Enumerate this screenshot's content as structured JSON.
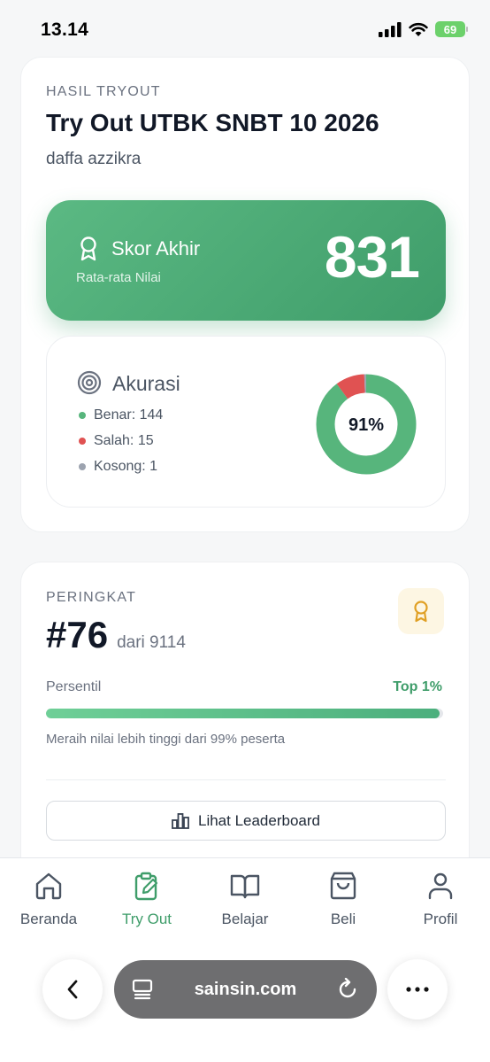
{
  "status_bar": {
    "time": "13.14",
    "battery": "69"
  },
  "result_card": {
    "overline": "HASIL TRYOUT",
    "title": "Try Out UTBK SNBT 10 2026",
    "student_name": "daffa azzikra",
    "score": {
      "label": "Skor Akhir",
      "sublabel": "Rata-rata Nilai",
      "value": "831"
    },
    "accuracy": {
      "title": "Akurasi",
      "percent_label": "91%",
      "items": [
        {
          "label": "Benar: 144",
          "count": 144,
          "color": "#57b57c"
        },
        {
          "label": "Salah: 15",
          "count": 15,
          "color": "#e05252"
        },
        {
          "label": "Kosong: 1",
          "count": 1,
          "color": "#9ca3af"
        }
      ]
    }
  },
  "rank_card": {
    "overline": "PERINGKAT",
    "rank": "#76",
    "of_text": "dari 9114",
    "percentile_label": "Persentil",
    "top_label": "Top 1%",
    "progress_fraction": 0.99,
    "note": "Meraih nilai lebih tinggi dari 99% peserta",
    "leaderboard_button": "Lihat Leaderboard"
  },
  "tabs": [
    {
      "label": "Beranda",
      "icon": "home-icon",
      "active": false
    },
    {
      "label": "Try Out",
      "icon": "clipboard-edit-icon",
      "active": true
    },
    {
      "label": "Belajar",
      "icon": "book-icon",
      "active": false
    },
    {
      "label": "Beli",
      "icon": "shopping-bag-icon",
      "active": false
    },
    {
      "label": "Profil",
      "icon": "user-icon",
      "active": false
    }
  ],
  "browser": {
    "url": "sainsin.com"
  },
  "colors": {
    "accent": "#3f9d6a",
    "correct": "#57b57c",
    "wrong": "#e05252",
    "empty": "#9ca3af"
  }
}
